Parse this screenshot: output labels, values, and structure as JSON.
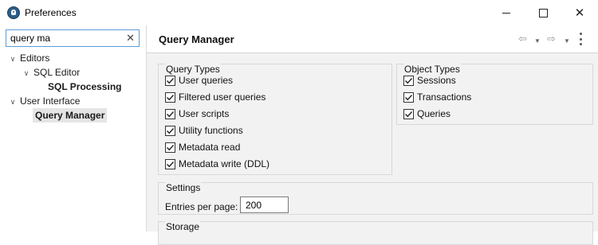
{
  "window": {
    "title": "Preferences",
    "controls": {
      "minimize": "—",
      "maximize": "☐",
      "close": "✕"
    }
  },
  "sidebar": {
    "filter": {
      "value": "query ma",
      "placeholder": ""
    },
    "tree": [
      {
        "label": "Editors",
        "level": 0,
        "expanded": true,
        "bold": false,
        "selected": false
      },
      {
        "label": "SQL Editor",
        "level": 1,
        "expanded": true,
        "bold": false,
        "selected": false
      },
      {
        "label": "SQL Processing",
        "level": 2,
        "expanded": false,
        "bold": true,
        "selected": false
      },
      {
        "label": "User Interface",
        "level": 0,
        "expanded": true,
        "bold": false,
        "selected": false
      },
      {
        "label": "Query Manager",
        "level": 1,
        "expanded": false,
        "bold": true,
        "selected": true
      }
    ]
  },
  "page": {
    "title": "Query Manager",
    "query_types": {
      "title": "Query Types",
      "items": [
        {
          "label": "User queries",
          "checked": true
        },
        {
          "label": "Filtered user queries",
          "checked": true
        },
        {
          "label": "User scripts",
          "checked": true
        },
        {
          "label": "Utility functions",
          "checked": true
        },
        {
          "label": "Metadata read",
          "checked": true
        },
        {
          "label": "Metadata write (DDL)",
          "checked": true
        }
      ]
    },
    "object_types": {
      "title": "Object Types",
      "items": [
        {
          "label": "Sessions",
          "checked": true
        },
        {
          "label": "Transactions",
          "checked": true
        },
        {
          "label": "Queries",
          "checked": true
        }
      ]
    },
    "settings": {
      "title": "Settings",
      "entries_label": "Entries per page:",
      "entries_value": "200"
    },
    "storage": {
      "title": "Storage"
    }
  },
  "icons": {
    "app": "dbeaver-icon",
    "clear": "clear-icon",
    "back": "back-arrow-icon",
    "forward": "forward-arrow-icon",
    "menu": "view-menu-icon"
  },
  "colors": {
    "filter_border": "#5a9bd6",
    "selection": "#e5e5e5",
    "panel_bg": "#f2f2f2"
  }
}
